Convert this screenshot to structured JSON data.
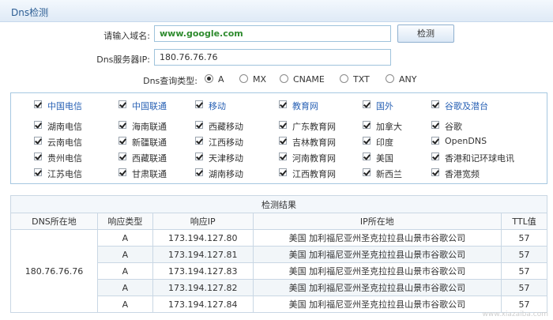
{
  "titlebar": {
    "title": "Dns检测"
  },
  "form": {
    "domain_label": "请输入域名:",
    "domain_value": "www.google.com",
    "dns_label": "Dns服务器IP:",
    "dns_value": "180.76.76.76",
    "detect_button": "检测"
  },
  "query_type": {
    "label": "Dns查询类型:",
    "options": [
      "A",
      "MX",
      "CNAME",
      "TXT",
      "ANY"
    ],
    "selected": "A"
  },
  "isps": {
    "header": [
      "中国电信",
      "中国联通",
      "移动",
      "教育网",
      "国外",
      "谷歌及潜台"
    ],
    "rows": [
      [
        "湖南电信",
        "海南联通",
        "西藏移动",
        "广东教育网",
        "加拿大",
        "谷歌"
      ],
      [
        "云南电信",
        "新疆联通",
        "江西移动",
        "吉林教育网",
        "印度",
        "OpenDNS"
      ],
      [
        "贵州电信",
        "西藏联通",
        "天津移动",
        "河南教育网",
        "美国",
        "香港和记环球电讯"
      ],
      [
        "江苏电信",
        "甘肃联通",
        "湖南移动",
        "江西教育网",
        "新西兰",
        "香港宽频"
      ]
    ]
  },
  "results": {
    "caption": "检测结果",
    "columns": [
      "DNS所在地",
      "响应类型",
      "响应IP",
      "IP所在地",
      "TTL值"
    ],
    "dns_location": "180.76.76.76",
    "rows": [
      {
        "type": "A",
        "ip": "173.194.127.80",
        "location": "美国 加利福尼亚州圣克拉拉县山景市谷歌公司",
        "ttl": "57"
      },
      {
        "type": "A",
        "ip": "173.194.127.81",
        "location": "美国 加利福尼亚州圣克拉拉县山景市谷歌公司",
        "ttl": "57"
      },
      {
        "type": "A",
        "ip": "173.194.127.83",
        "location": "美国 加利福尼亚州圣克拉拉县山景市谷歌公司",
        "ttl": "57"
      },
      {
        "type": "A",
        "ip": "173.194.127.82",
        "location": "美国 加利福尼亚州圣克拉拉县山景市谷歌公司",
        "ttl": "57"
      },
      {
        "type": "A",
        "ip": "173.194.127.84",
        "location": "美国 加利福尼亚州圣克拉拉县山景市谷歌公司",
        "ttl": "57"
      }
    ]
  },
  "watermark": "www.xiazaiba.com"
}
